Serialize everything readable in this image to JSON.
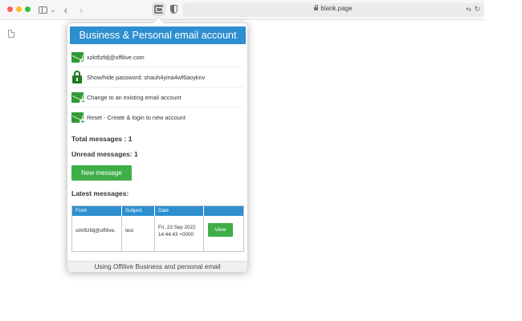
{
  "browser": {
    "url": "blank.page",
    "icons": [
      "sidebar-icon",
      "chevron-down-icon",
      "back-icon",
      "forward-icon",
      "extension-icon",
      "shield-icon",
      "lock-icon",
      "translate-icon",
      "reload-icon",
      "document-icon"
    ],
    "back_glyph": "‹",
    "forward_glyph": "›",
    "chevron_glyph": "⌄",
    "translate_glyph": "⇆",
    "reload_glyph": "↻"
  },
  "popup": {
    "title": "Business & Personal email account",
    "items": [
      {
        "icon": "envelope-check-icon",
        "text": "xzktfizfdj@offilive.com"
      },
      {
        "icon": "padlock-icon",
        "text": "Show/hide password: shauh4yina4wf6aoyknv"
      },
      {
        "icon": "envelope-arrow-icon",
        "text": "Change to an existing email account"
      },
      {
        "icon": "envelope-plus-icon",
        "text": "Reset - Create & login to new account"
      }
    ],
    "total_messages": "Total messages : 1",
    "unread_messages": "Unread messages: 1",
    "new_message_label": "New message",
    "latest_messages_heading": "Latest messages:",
    "table": {
      "headers": [
        "From",
        "Subject",
        "Date",
        ""
      ],
      "rows": [
        {
          "from": "xzktfizfdj@offilive.",
          "subject": "test",
          "date": "Fri, 23 Sep 2022 14:44:43 +0000",
          "action": "View"
        }
      ]
    },
    "footer": "Using Offilive Business and personal email"
  },
  "colors": {
    "header_blue": "#2d8fcf",
    "button_green": "#3fae49",
    "icon_green": "#2f9a3a"
  }
}
